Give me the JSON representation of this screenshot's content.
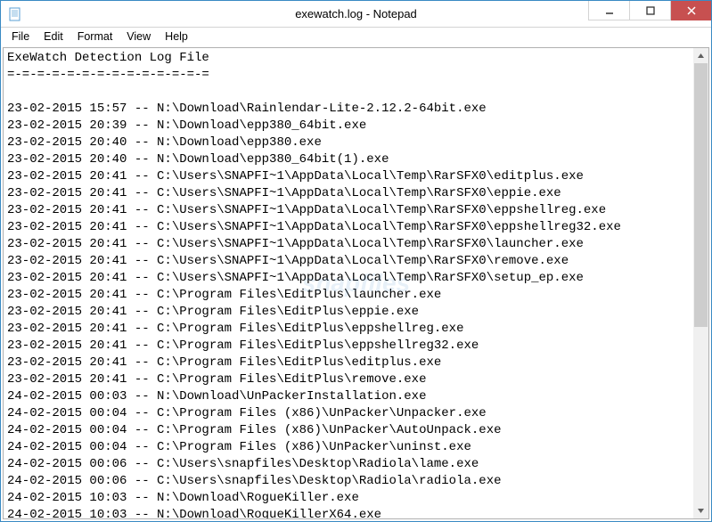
{
  "titlebar": {
    "title": "exewatch.log - Notepad"
  },
  "menu": {
    "items": [
      "File",
      "Edit",
      "Format",
      "View",
      "Help"
    ]
  },
  "content": {
    "header": "ExeWatch Detection Log File",
    "separator": "=-=-=-=-=-=-=-=-=-=-=-=-=-=",
    "lines": [
      "23-02-2015 15:57 -- N:\\Download\\Rainlendar-Lite-2.12.2-64bit.exe",
      "23-02-2015 20:39 -- N:\\Download\\epp380_64bit.exe",
      "23-02-2015 20:40 -- N:\\Download\\epp380.exe",
      "23-02-2015 20:40 -- N:\\Download\\epp380_64bit(1).exe",
      "23-02-2015 20:41 -- C:\\Users\\SNAPFI~1\\AppData\\Local\\Temp\\RarSFX0\\editplus.exe",
      "23-02-2015 20:41 -- C:\\Users\\SNAPFI~1\\AppData\\Local\\Temp\\RarSFX0\\eppie.exe",
      "23-02-2015 20:41 -- C:\\Users\\SNAPFI~1\\AppData\\Local\\Temp\\RarSFX0\\eppshellreg.exe",
      "23-02-2015 20:41 -- C:\\Users\\SNAPFI~1\\AppData\\Local\\Temp\\RarSFX0\\eppshellreg32.exe",
      "23-02-2015 20:41 -- C:\\Users\\SNAPFI~1\\AppData\\Local\\Temp\\RarSFX0\\launcher.exe",
      "23-02-2015 20:41 -- C:\\Users\\SNAPFI~1\\AppData\\Local\\Temp\\RarSFX0\\remove.exe",
      "23-02-2015 20:41 -- C:\\Users\\SNAPFI~1\\AppData\\Local\\Temp\\RarSFX0\\setup_ep.exe",
      "23-02-2015 20:41 -- C:\\Program Files\\EditPlus\\launcher.exe",
      "23-02-2015 20:41 -- C:\\Program Files\\EditPlus\\eppie.exe",
      "23-02-2015 20:41 -- C:\\Program Files\\EditPlus\\eppshellreg.exe",
      "23-02-2015 20:41 -- C:\\Program Files\\EditPlus\\eppshellreg32.exe",
      "23-02-2015 20:41 -- C:\\Program Files\\EditPlus\\editplus.exe",
      "23-02-2015 20:41 -- C:\\Program Files\\EditPlus\\remove.exe",
      "24-02-2015 00:03 -- N:\\Download\\UnPackerInstallation.exe",
      "24-02-2015 00:04 -- C:\\Program Files (x86)\\UnPacker\\Unpacker.exe",
      "24-02-2015 00:04 -- C:\\Program Files (x86)\\UnPacker\\AutoUnpack.exe",
      "24-02-2015 00:04 -- C:\\Program Files (x86)\\UnPacker\\uninst.exe",
      "24-02-2015 00:06 -- C:\\Users\\snapfiles\\Desktop\\Radiola\\lame.exe",
      "24-02-2015 00:06 -- C:\\Users\\snapfiles\\Desktop\\Radiola\\radiola.exe",
      "24-02-2015 10:03 -- N:\\Download\\RogueKiller.exe",
      "24-02-2015 10:03 -- N:\\Download\\RogueKillerX64.exe"
    ]
  },
  "watermark": "snapfiles"
}
